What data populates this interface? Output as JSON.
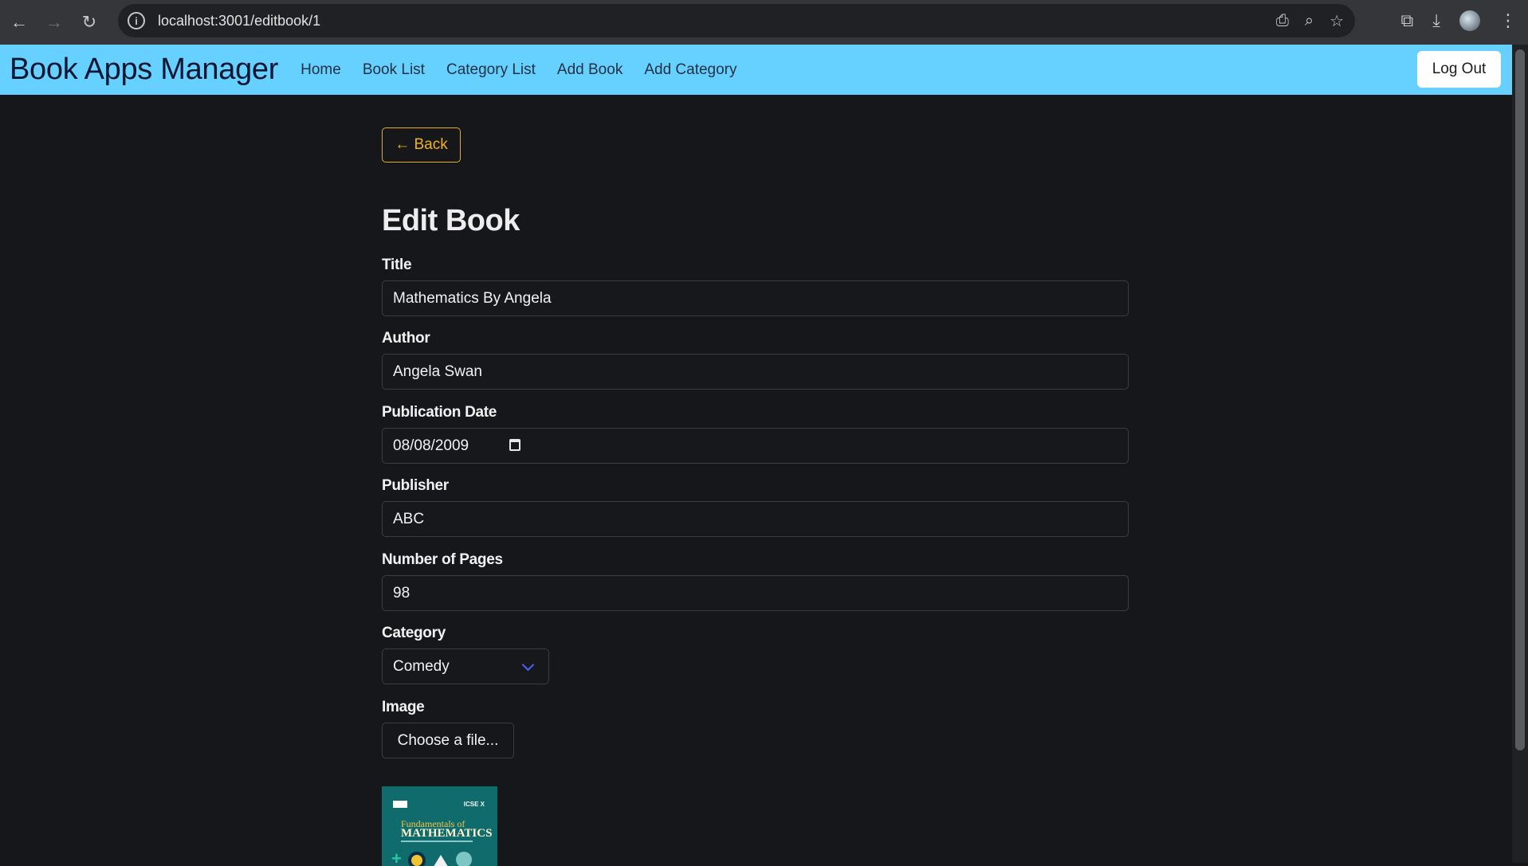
{
  "browser": {
    "url": "localhost:3001/editbook/1"
  },
  "navbar": {
    "brand": "Book Apps Manager",
    "links": [
      {
        "label": "Home"
      },
      {
        "label": "Book List"
      },
      {
        "label": "Category List"
      },
      {
        "label": "Add Book"
      },
      {
        "label": "Add Category"
      }
    ],
    "logout_label": "Log Out",
    "background_color": "#66d1ff"
  },
  "form": {
    "back_label": "← Back",
    "title": "Edit Book",
    "fields": {
      "title": {
        "label": "Title",
        "value": "Mathematics By Angela"
      },
      "author": {
        "label": "Author",
        "value": "Angela Swan"
      },
      "publication_date": {
        "label": "Publication Date",
        "value": "08/08/2009"
      },
      "publisher": {
        "label": "Publisher",
        "value": "ABC"
      },
      "pages": {
        "label": "Number of Pages",
        "value": "98"
      },
      "category": {
        "label": "Category",
        "value": "Comedy"
      },
      "image": {
        "label": "Image",
        "button_label": "Choose a file..."
      }
    },
    "accent_color": "#f2b21f"
  },
  "cover": {
    "badge": "ICSE X",
    "line1": "Fundamentals of",
    "line2": "MATHEMATICS"
  }
}
